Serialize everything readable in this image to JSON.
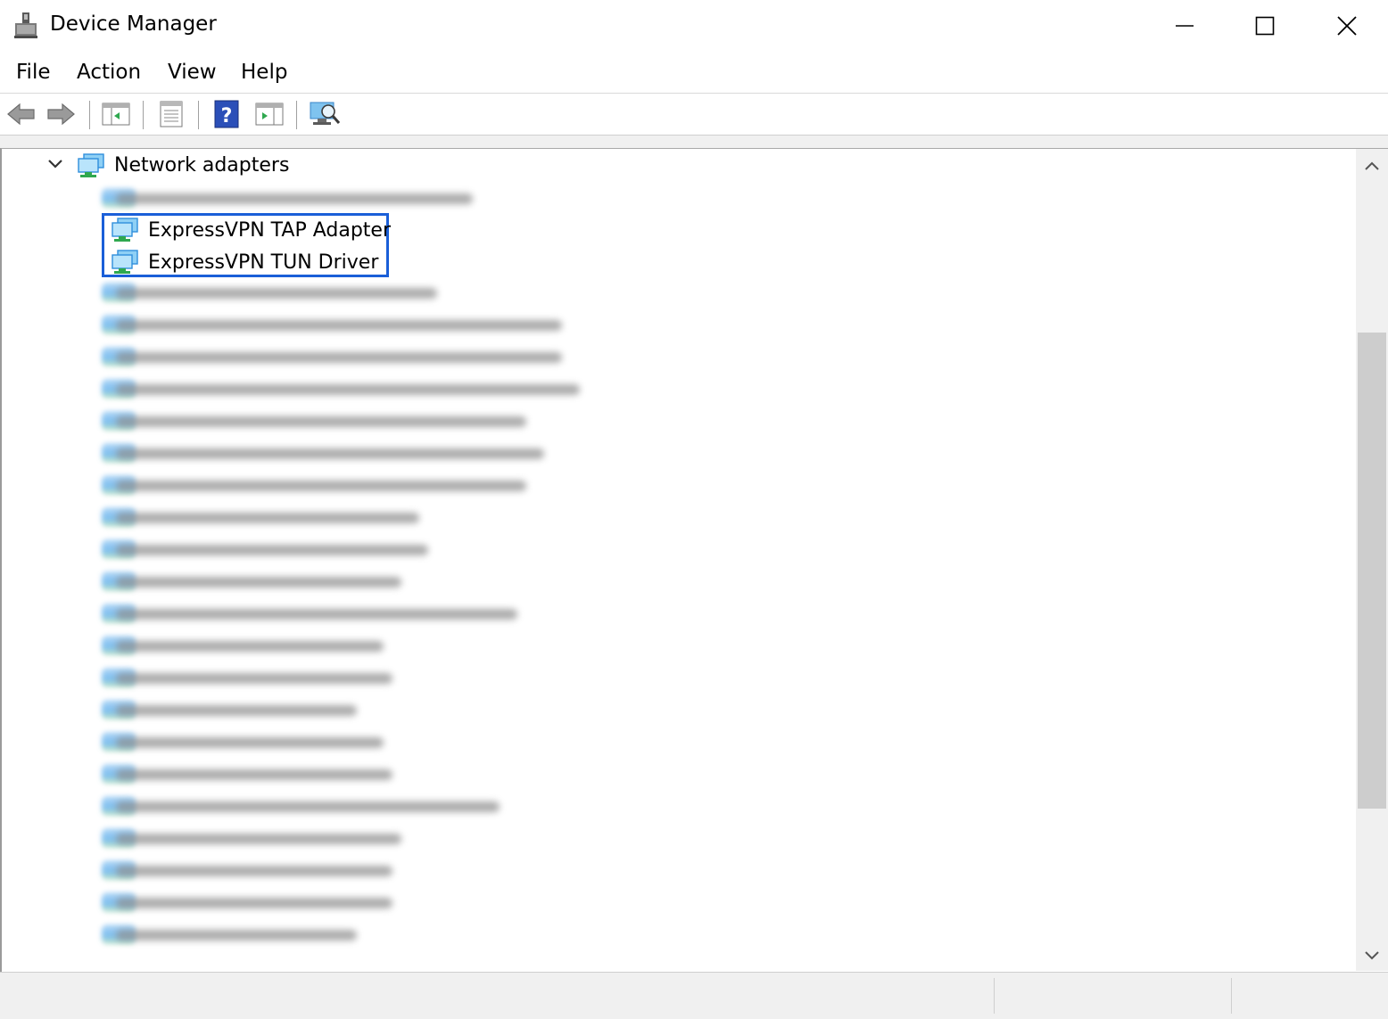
{
  "window": {
    "title": "Device Manager",
    "icons": {
      "app": "device-manager-icon",
      "minimize": "minimize-icon",
      "maximize": "maximize-icon",
      "close": "close-icon"
    }
  },
  "menu": {
    "items": [
      {
        "label": "File"
      },
      {
        "label": "Action"
      },
      {
        "label": "View"
      },
      {
        "label": "Help"
      }
    ]
  },
  "toolbar": {
    "buttons": [
      "back-arrow-icon",
      "forward-arrow-icon",
      "show-hide-console-tree-icon",
      "properties-icon",
      "help-icon",
      "action-pane-icon",
      "scan-hardware-changes-icon"
    ]
  },
  "tree": {
    "category": {
      "label": "Network adapters",
      "icon": "network-adapter-icon",
      "expanded": true
    },
    "devices": [
      {
        "label": "ExpressVPN TAP Adapter",
        "icon": "network-adapter-icon",
        "highlighted": true
      },
      {
        "label": "ExpressVPN TUN Driver",
        "icon": "network-adapter-icon",
        "highlighted": true
      }
    ],
    "redacted_items_count": 25
  },
  "colors": {
    "highlight_border": "#1a5fd8",
    "icon_blue": "#2f8fdc",
    "icon_green": "#2fa84f",
    "scrollbar_track": "#f0f0f0",
    "scrollbar_thumb": "#cdcdcd"
  }
}
